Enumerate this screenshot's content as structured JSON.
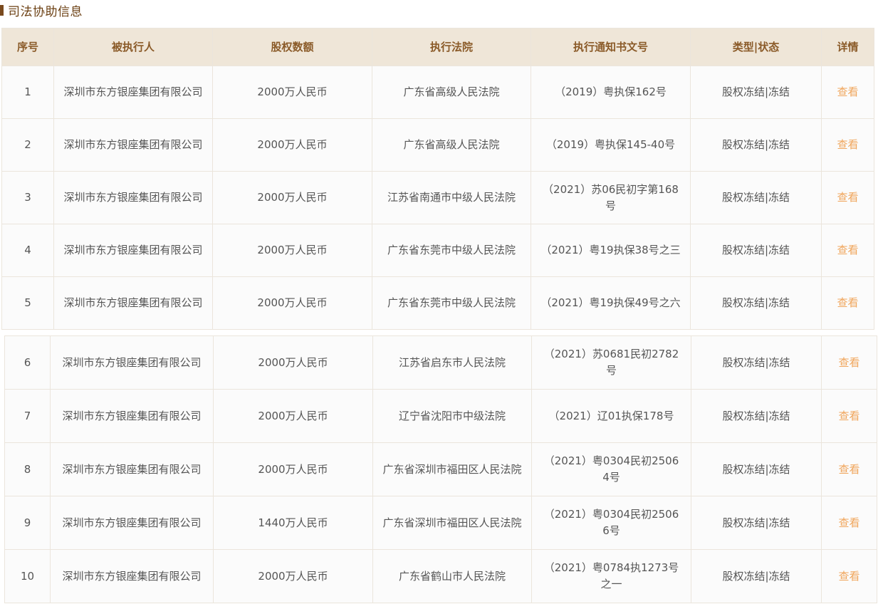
{
  "section": {
    "title": "司法协助信息"
  },
  "table": {
    "headers": [
      "序号",
      "被执行人",
      "股权数额",
      "执行法院",
      "执行通知书文号",
      "类型|状态",
      "详情"
    ],
    "rows": [
      {
        "index": "1",
        "executee": "深圳市东方银座集团有限公司",
        "amount": "2000万人民币",
        "court": "广东省高级人民法院",
        "doc_no": "（2019）粤执保162号",
        "status": "股权冻结|冻结",
        "detail": "查看"
      },
      {
        "index": "2",
        "executee": "深圳市东方银座集团有限公司",
        "amount": "2000万人民币",
        "court": "广东省高级人民法院",
        "doc_no": "（2019）粤执保145-40号",
        "status": "股权冻结|冻结",
        "detail": "查看"
      },
      {
        "index": "3",
        "executee": "深圳市东方银座集团有限公司",
        "amount": "2000万人民币",
        "court": "江苏省南通市中级人民法院",
        "doc_no": "（2021）苏06民初字第168号",
        "status": "股权冻结|冻结",
        "detail": "查看"
      },
      {
        "index": "4",
        "executee": "深圳市东方银座集团有限公司",
        "amount": "2000万人民币",
        "court": "广东省东莞市中级人民法院",
        "doc_no": "（2021）粤19执保38号之三",
        "status": "股权冻结|冻结",
        "detail": "查看"
      },
      {
        "index": "5",
        "executee": "深圳市东方银座集团有限公司",
        "amount": "2000万人民币",
        "court": "广东省东莞市中级人民法院",
        "doc_no": "（2021）粤19执保49号之六",
        "status": "股权冻结|冻结",
        "detail": "查看"
      },
      {
        "index": "6",
        "executee": "深圳市东方银座集团有限公司",
        "amount": "2000万人民币",
        "court": "江苏省启东市人民法院",
        "doc_no": "（2021）苏0681民初2782号",
        "status": "股权冻结|冻结",
        "detail": "查看"
      },
      {
        "index": "7",
        "executee": "深圳市东方银座集团有限公司",
        "amount": "2000万人民币",
        "court": "辽宁省沈阳市中级法院",
        "doc_no": "（2021）辽01执保178号",
        "status": "股权冻结|冻结",
        "detail": "查看"
      },
      {
        "index": "8",
        "executee": "深圳市东方银座集团有限公司",
        "amount": "2000万人民币",
        "court": "广东省深圳市福田区人民法院",
        "doc_no": "（2021）粤0304民初25064号",
        "status": "股权冻结|冻结",
        "detail": "查看"
      },
      {
        "index": "9",
        "executee": "深圳市东方银座集团有限公司",
        "amount": "1440万人民币",
        "court": "广东省深圳市福田区人民法院",
        "doc_no": "（2021）粤0304民初25066号",
        "status": "股权冻结|冻结",
        "detail": "查看"
      },
      {
        "index": "10",
        "executee": "深圳市东方银座集团有限公司",
        "amount": "2000万人民币",
        "court": "广东省鹤山市人民法院",
        "doc_no": "（2021）粤0784执1273号之一",
        "status": "股权冻结|冻结",
        "detail": "查看"
      }
    ]
  },
  "colors": {
    "title_accent": "#7a4a1e",
    "header_bg": "#efe6d8",
    "header_text": "#8a5a28",
    "link_text": "#f0a55b"
  }
}
